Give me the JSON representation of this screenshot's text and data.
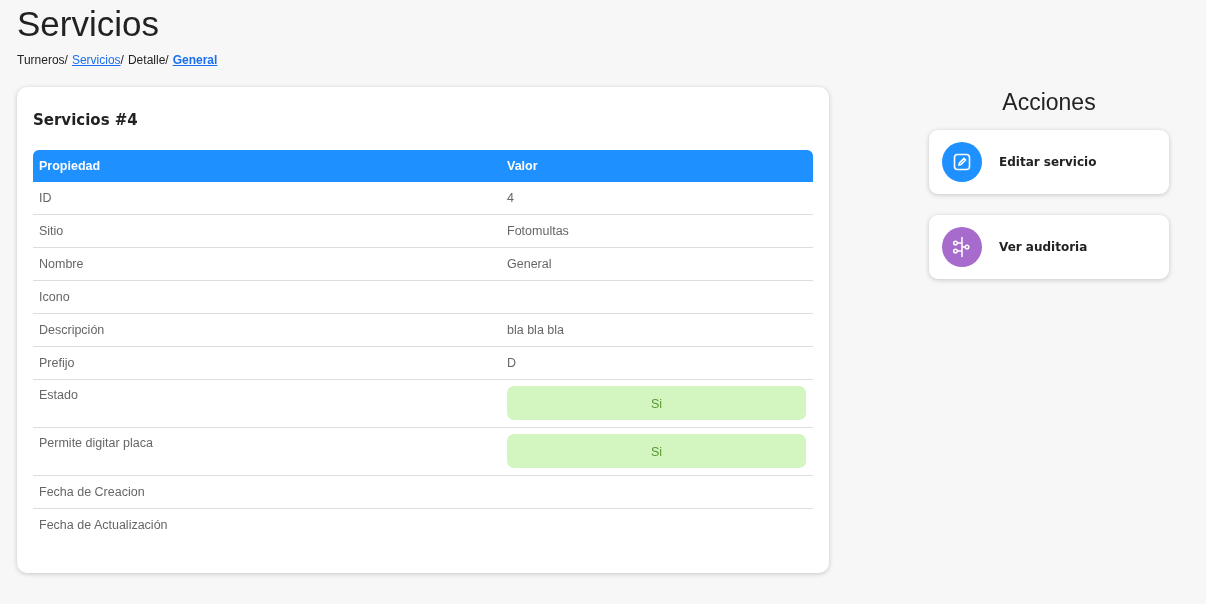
{
  "page_title": "Servicios",
  "breadcrumb_separator": "/",
  "breadcrumb": [
    {
      "label": "Turneros",
      "kind": "text"
    },
    {
      "label": "Servicios",
      "kind": "link"
    },
    {
      "label": "Detalle",
      "kind": "text"
    },
    {
      "label": "General",
      "kind": "current"
    }
  ],
  "card": {
    "title": "Servicios #4",
    "columns": [
      "Propiedad",
      "Valor"
    ],
    "rows": [
      {
        "property": "ID",
        "kind": "text",
        "value": "4"
      },
      {
        "property": "Sitio",
        "kind": "text",
        "value": "Fotomultas"
      },
      {
        "property": "Nombre",
        "kind": "text",
        "value": "General"
      },
      {
        "property": "Icono",
        "kind": "text"
      },
      {
        "property": "Descripción",
        "kind": "text",
        "value": "bla bla bla"
      },
      {
        "property": "Prefijo",
        "kind": "text",
        "value": "D"
      },
      {
        "property": "Estado",
        "kind": "tag",
        "value": "Si"
      },
      {
        "property": "Permite digitar placa",
        "kind": "tag",
        "value": "Si"
      },
      {
        "property": "Fecha de Creacion",
        "kind": "text"
      },
      {
        "property": "Fecha de Actualización",
        "kind": "text"
      }
    ]
  },
  "actions": {
    "title": "Acciones",
    "items": [
      {
        "label": "Editar servicio",
        "kind": "edit",
        "color": "#1e90ff"
      },
      {
        "label": "Ver auditoria",
        "kind": "audit",
        "color": "#a66bcc"
      }
    ]
  }
}
